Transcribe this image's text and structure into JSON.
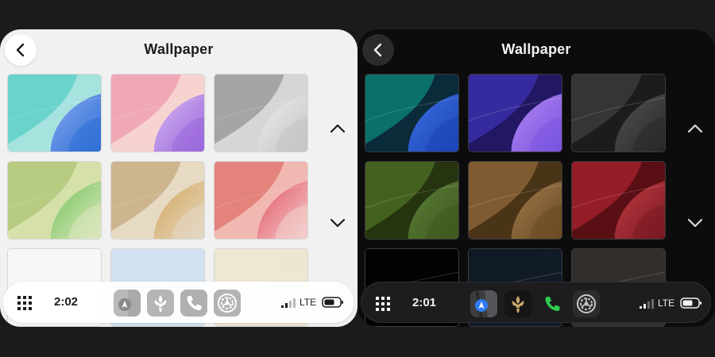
{
  "light": {
    "title": "Wallpaper",
    "time": "2:02",
    "network": "LTE",
    "apps": [
      "maps-icon",
      "saints-icon",
      "phone-icon",
      "settings-icon"
    ],
    "wallpapers": [
      {
        "name": "teal-blue",
        "bg": "#a6e3de",
        "c1": "#5fd1c9",
        "c2": "#2f6fd6",
        "c3": "#86a8ef"
      },
      {
        "name": "pink-purple",
        "bg": "#f6d3cf",
        "c1": "#eea0b3",
        "c2": "#9a68dc",
        "c3": "#d6b7f0"
      },
      {
        "name": "gray",
        "bg": "#d6d6d6",
        "c1": "#9c9c9c",
        "c2": "#c4c4c4",
        "c3": "#eeeeee"
      },
      {
        "name": "olive-green",
        "bg": "#d6e1aa",
        "c1": "#b2c77a",
        "c2": "#dce7bd",
        "c3": "#72c25a"
      },
      {
        "name": "sand",
        "bg": "#e6dac3",
        "c1": "#c8ae86",
        "c2": "#e3d7c2",
        "c3": "#d4a659"
      },
      {
        "name": "coral",
        "bg": "#f1b8b1",
        "c1": "#e17972",
        "c2": "#f3cfcc",
        "c3": "#e15060"
      },
      {
        "name": "white",
        "bg": "#f7f7f7",
        "c1": "#f7f7f7",
        "c2": "#f7f7f7",
        "c3": "#f7f7f7"
      },
      {
        "name": "pale-blue",
        "bg": "#d1e1ef",
        "c1": "#d1e1ef",
        "c2": "#d1e1ef",
        "c3": "#d1e1ef"
      },
      {
        "name": "cream",
        "bg": "#ede6d1",
        "c1": "#ede6d1",
        "c2": "#ede6d1",
        "c3": "#ede6d1"
      }
    ]
  },
  "dark": {
    "title": "Wallpaper",
    "time": "2:01",
    "network": "LTE",
    "apps": [
      "maps-icon",
      "saints-icon",
      "phone-icon",
      "settings-icon"
    ],
    "wallpapers": [
      {
        "name": "teal-blue",
        "bg": "#0b2a3a",
        "c1": "#0c7d76",
        "c2": "#1c45b8",
        "c3": "#3b6fe0"
      },
      {
        "name": "indigo-purple",
        "bg": "#221763",
        "c1": "#3a2fa8",
        "c2": "#7b55e0",
        "c3": "#b085f0"
      },
      {
        "name": "charcoal",
        "bg": "#1c1c1c",
        "c1": "#3a3a3a",
        "c2": "#2a2a2a",
        "c3": "#525252"
      },
      {
        "name": "olive",
        "bg": "#263510",
        "c1": "#4a6a22",
        "c2": "#3f5a1d",
        "c3": "#5c7f3a"
      },
      {
        "name": "bronze",
        "bg": "#4a3418",
        "c1": "#8a6336",
        "c2": "#6b4b24",
        "c3": "#a07b4c"
      },
      {
        "name": "crimson",
        "bg": "#5a0f14",
        "c1": "#a0202a",
        "c2": "#7a1a22",
        "c3": "#c23a44"
      },
      {
        "name": "black",
        "bg": "#020202",
        "c1": "#020202",
        "c2": "#020202",
        "c3": "#020202"
      },
      {
        "name": "navy",
        "bg": "#111a27",
        "c1": "#111a27",
        "c2": "#111a27",
        "c3": "#111a27"
      },
      {
        "name": "taupe",
        "bg": "#332e2b",
        "c1": "#332e2b",
        "c2": "#332e2b",
        "c3": "#332e2b"
      }
    ]
  }
}
